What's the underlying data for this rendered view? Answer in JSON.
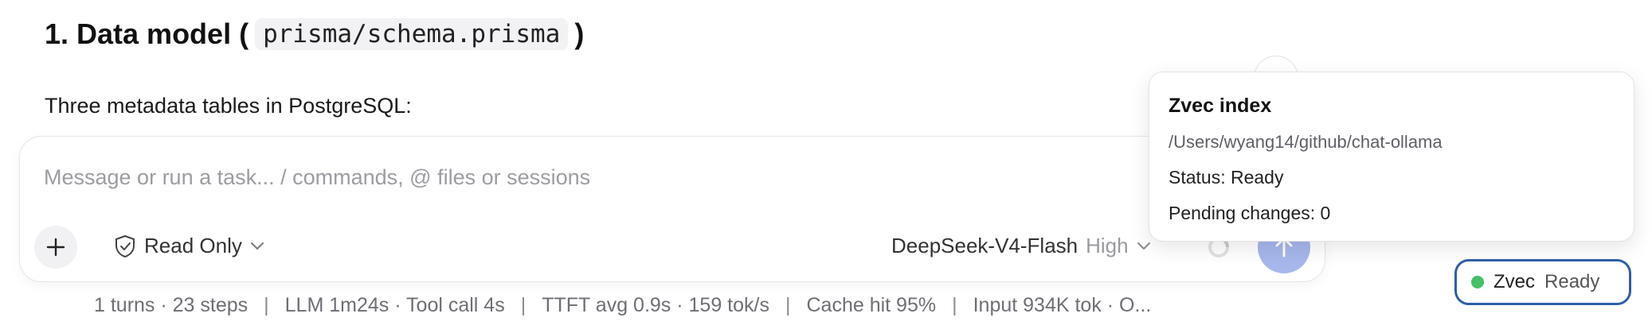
{
  "heading": {
    "prefix": "1. Data model (",
    "code": "prisma/schema.prisma",
    "suffix": ")"
  },
  "paragraph": "Three metadata tables in PostgreSQL:",
  "composer": {
    "placeholder": "Message or run a task... / commands, @ files or sessions",
    "add_icon": "plus-icon",
    "mode_label": "Read Only",
    "mode_icon": "shield-check-icon",
    "model_name": "DeepSeek-V4-Flash",
    "model_level": "High",
    "send_icon": "arrow-up-icon",
    "accent_color": "#a7b7ec"
  },
  "stats": {
    "turns": "1 turns · 23 steps",
    "llm": "LLM 1m24s · Tool call 4s",
    "ttft": "TTFT avg 0.9s · 159 tok/s",
    "cache": "Cache hit 95%",
    "input": "Input 934K tok · O..."
  },
  "popover": {
    "title": "Zvec index",
    "path": "/Users/wyang14/github/chat-ollama",
    "status": "Status: Ready",
    "pending": "Pending changes: 0"
  },
  "status_pill": {
    "label": "Zvec",
    "state": "Ready",
    "dot_color": "#45c167",
    "border_color": "#2e5ea8"
  }
}
